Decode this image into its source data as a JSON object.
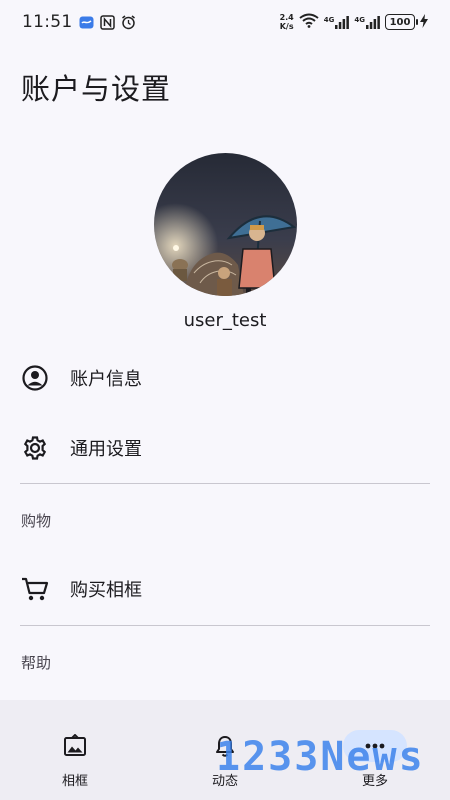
{
  "status_bar": {
    "time": "11:51",
    "net_speed_value": "2.4",
    "net_speed_unit": "K/s",
    "signal_1": "4G",
    "signal_2": "4G",
    "battery": "100"
  },
  "header": {
    "title": "账户与设置"
  },
  "profile": {
    "username": "user_test"
  },
  "menu": {
    "account_info": "账户信息",
    "general_settings": "通用设置",
    "shopping_section": "购物",
    "buy_frame": "购买相框",
    "help_section": "帮助"
  },
  "bottom_nav": {
    "items": [
      {
        "label": "相框",
        "icon": "image-frame-icon"
      },
      {
        "label": "动态",
        "icon": "bell-icon"
      },
      {
        "label": "更多",
        "icon": "more-dots-icon"
      }
    ],
    "active_index": 2
  },
  "watermark": {
    "text": "1233News"
  },
  "colors": {
    "background": "#f8f7fc",
    "nav_background": "#eeedf3",
    "active_indicator": "#d5e4ff",
    "divider": "#c9c7cf"
  }
}
